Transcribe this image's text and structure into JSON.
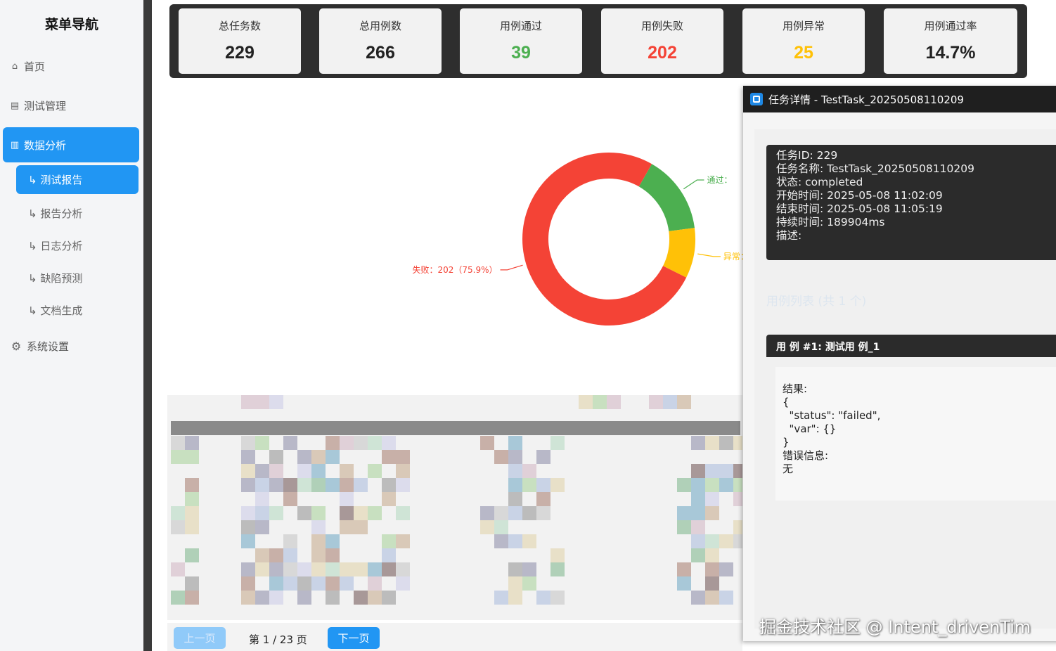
{
  "sidebar": {
    "title": "菜单导航",
    "items": [
      {
        "icon": "home-icon",
        "glyph": "⌂",
        "label": "首页"
      },
      {
        "icon": "document-icon",
        "glyph": "▤",
        "label": "测试管理"
      },
      {
        "icon": "bar-chart-icon",
        "glyph": "▥",
        "label": "数据分析"
      }
    ],
    "sub_items": [
      "↳ 测试报告",
      "↳ 报告分析",
      "↳ 日志分析",
      "↳ 缺陷预测",
      "↳ 文档生成"
    ],
    "settings": {
      "icon": "gear-icon",
      "glyph": "⚙",
      "label": "系统设置"
    }
  },
  "stats": [
    {
      "label": "总任务数",
      "value": "229",
      "color": "#222222"
    },
    {
      "label": "总用例数",
      "value": "266",
      "color": "#222222"
    },
    {
      "label": "用例通过",
      "value": "39",
      "color": "#4caf50"
    },
    {
      "label": "用例失败",
      "value": "202",
      "color": "#f44336"
    },
    {
      "label": "用例异常",
      "value": "25",
      "color": "#ffc107"
    },
    {
      "label": "用例通过率",
      "value": "14.7%",
      "color": "#222222"
    }
  ],
  "chart_data": {
    "type": "pie",
    "slices": [
      {
        "name": "通过",
        "value": 39,
        "label": "通过：",
        "color": "#4caf50"
      },
      {
        "name": "异常",
        "value": 25,
        "label": "异常：",
        "color": "#ffc107"
      },
      {
        "name": "失败",
        "value": 202,
        "label": "失败：202（75.9%）",
        "color": "#f44336"
      }
    ]
  },
  "pagination": {
    "prev": "上一页",
    "info": "第 1 / 23 页",
    "next": "下一页"
  },
  "dialog": {
    "title": "任务详情 - TestTask_20250508110209",
    "info_lines": [
      "任务ID: 229",
      "任务名称: TestTask_20250508110209",
      "状态: completed",
      "开始时间: 2025-05-08 11:02:09",
      "结束时间: 2025-05-08 11:05:19",
      "持续时间: 189904ms",
      "描述:"
    ],
    "case_list_title": "用例列表 (共 1 个)",
    "case_header": "用 例 #1: 测试用 例_1",
    "case_lines": [
      "结果:",
      "{",
      "  \"status\": \"failed\",",
      "  \"var\": {}",
      "}",
      "",
      "错误信息:",
      "无"
    ]
  },
  "watermark": "掘金技术社区 @ Intent_drivenTim"
}
